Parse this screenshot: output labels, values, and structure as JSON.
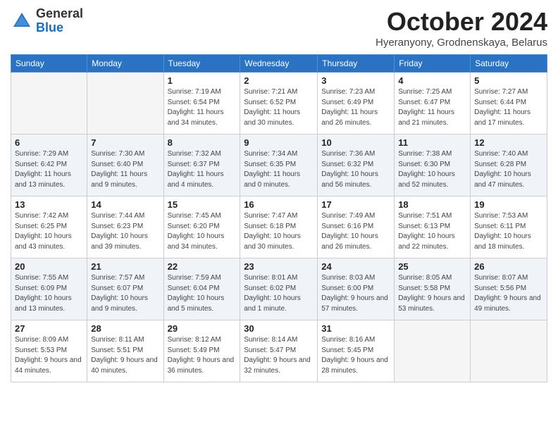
{
  "header": {
    "logo_line1": "General",
    "logo_line2": "Blue",
    "month": "October 2024",
    "location": "Hyeranyony, Grodnenskaya, Belarus"
  },
  "days_of_week": [
    "Sunday",
    "Monday",
    "Tuesday",
    "Wednesday",
    "Thursday",
    "Friday",
    "Saturday"
  ],
  "weeks": [
    [
      {
        "day": "",
        "empty": true
      },
      {
        "day": "",
        "empty": true
      },
      {
        "day": "1",
        "sunrise": "Sunrise: 7:19 AM",
        "sunset": "Sunset: 6:54 PM",
        "daylight": "Daylight: 11 hours and 34 minutes."
      },
      {
        "day": "2",
        "sunrise": "Sunrise: 7:21 AM",
        "sunset": "Sunset: 6:52 PM",
        "daylight": "Daylight: 11 hours and 30 minutes."
      },
      {
        "day": "3",
        "sunrise": "Sunrise: 7:23 AM",
        "sunset": "Sunset: 6:49 PM",
        "daylight": "Daylight: 11 hours and 26 minutes."
      },
      {
        "day": "4",
        "sunrise": "Sunrise: 7:25 AM",
        "sunset": "Sunset: 6:47 PM",
        "daylight": "Daylight: 11 hours and 21 minutes."
      },
      {
        "day": "5",
        "sunrise": "Sunrise: 7:27 AM",
        "sunset": "Sunset: 6:44 PM",
        "daylight": "Daylight: 11 hours and 17 minutes."
      }
    ],
    [
      {
        "day": "6",
        "sunrise": "Sunrise: 7:29 AM",
        "sunset": "Sunset: 6:42 PM",
        "daylight": "Daylight: 11 hours and 13 minutes."
      },
      {
        "day": "7",
        "sunrise": "Sunrise: 7:30 AM",
        "sunset": "Sunset: 6:40 PM",
        "daylight": "Daylight: 11 hours and 9 minutes."
      },
      {
        "day": "8",
        "sunrise": "Sunrise: 7:32 AM",
        "sunset": "Sunset: 6:37 PM",
        "daylight": "Daylight: 11 hours and 4 minutes."
      },
      {
        "day": "9",
        "sunrise": "Sunrise: 7:34 AM",
        "sunset": "Sunset: 6:35 PM",
        "daylight": "Daylight: 11 hours and 0 minutes."
      },
      {
        "day": "10",
        "sunrise": "Sunrise: 7:36 AM",
        "sunset": "Sunset: 6:32 PM",
        "daylight": "Daylight: 10 hours and 56 minutes."
      },
      {
        "day": "11",
        "sunrise": "Sunrise: 7:38 AM",
        "sunset": "Sunset: 6:30 PM",
        "daylight": "Daylight: 10 hours and 52 minutes."
      },
      {
        "day": "12",
        "sunrise": "Sunrise: 7:40 AM",
        "sunset": "Sunset: 6:28 PM",
        "daylight": "Daylight: 10 hours and 47 minutes."
      }
    ],
    [
      {
        "day": "13",
        "sunrise": "Sunrise: 7:42 AM",
        "sunset": "Sunset: 6:25 PM",
        "daylight": "Daylight: 10 hours and 43 minutes."
      },
      {
        "day": "14",
        "sunrise": "Sunrise: 7:44 AM",
        "sunset": "Sunset: 6:23 PM",
        "daylight": "Daylight: 10 hours and 39 minutes."
      },
      {
        "day": "15",
        "sunrise": "Sunrise: 7:45 AM",
        "sunset": "Sunset: 6:20 PM",
        "daylight": "Daylight: 10 hours and 34 minutes."
      },
      {
        "day": "16",
        "sunrise": "Sunrise: 7:47 AM",
        "sunset": "Sunset: 6:18 PM",
        "daylight": "Daylight: 10 hours and 30 minutes."
      },
      {
        "day": "17",
        "sunrise": "Sunrise: 7:49 AM",
        "sunset": "Sunset: 6:16 PM",
        "daylight": "Daylight: 10 hours and 26 minutes."
      },
      {
        "day": "18",
        "sunrise": "Sunrise: 7:51 AM",
        "sunset": "Sunset: 6:13 PM",
        "daylight": "Daylight: 10 hours and 22 minutes."
      },
      {
        "day": "19",
        "sunrise": "Sunrise: 7:53 AM",
        "sunset": "Sunset: 6:11 PM",
        "daylight": "Daylight: 10 hours and 18 minutes."
      }
    ],
    [
      {
        "day": "20",
        "sunrise": "Sunrise: 7:55 AM",
        "sunset": "Sunset: 6:09 PM",
        "daylight": "Daylight: 10 hours and 13 minutes."
      },
      {
        "day": "21",
        "sunrise": "Sunrise: 7:57 AM",
        "sunset": "Sunset: 6:07 PM",
        "daylight": "Daylight: 10 hours and 9 minutes."
      },
      {
        "day": "22",
        "sunrise": "Sunrise: 7:59 AM",
        "sunset": "Sunset: 6:04 PM",
        "daylight": "Daylight: 10 hours and 5 minutes."
      },
      {
        "day": "23",
        "sunrise": "Sunrise: 8:01 AM",
        "sunset": "Sunset: 6:02 PM",
        "daylight": "Daylight: 10 hours and 1 minute."
      },
      {
        "day": "24",
        "sunrise": "Sunrise: 8:03 AM",
        "sunset": "Sunset: 6:00 PM",
        "daylight": "Daylight: 9 hours and 57 minutes."
      },
      {
        "day": "25",
        "sunrise": "Sunrise: 8:05 AM",
        "sunset": "Sunset: 5:58 PM",
        "daylight": "Daylight: 9 hours and 53 minutes."
      },
      {
        "day": "26",
        "sunrise": "Sunrise: 8:07 AM",
        "sunset": "Sunset: 5:56 PM",
        "daylight": "Daylight: 9 hours and 49 minutes."
      }
    ],
    [
      {
        "day": "27",
        "sunrise": "Sunrise: 8:09 AM",
        "sunset": "Sunset: 5:53 PM",
        "daylight": "Daylight: 9 hours and 44 minutes."
      },
      {
        "day": "28",
        "sunrise": "Sunrise: 8:11 AM",
        "sunset": "Sunset: 5:51 PM",
        "daylight": "Daylight: 9 hours and 40 minutes."
      },
      {
        "day": "29",
        "sunrise": "Sunrise: 8:12 AM",
        "sunset": "Sunset: 5:49 PM",
        "daylight": "Daylight: 9 hours and 36 minutes."
      },
      {
        "day": "30",
        "sunrise": "Sunrise: 8:14 AM",
        "sunset": "Sunset: 5:47 PM",
        "daylight": "Daylight: 9 hours and 32 minutes."
      },
      {
        "day": "31",
        "sunrise": "Sunrise: 8:16 AM",
        "sunset": "Sunset: 5:45 PM",
        "daylight": "Daylight: 9 hours and 28 minutes."
      },
      {
        "day": "",
        "empty": true
      },
      {
        "day": "",
        "empty": true
      }
    ]
  ]
}
